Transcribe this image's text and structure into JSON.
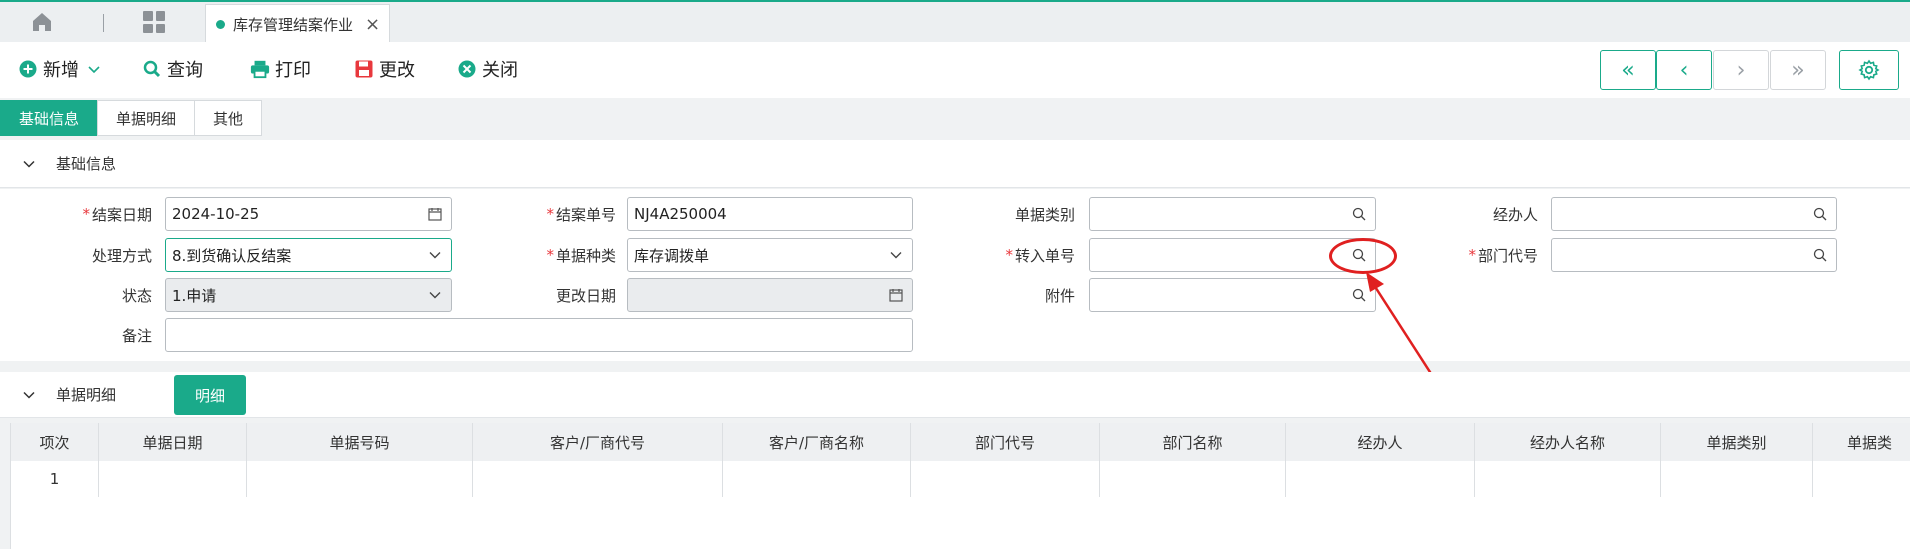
{
  "tabbar": {
    "home_icon": "home-icon",
    "apps_icon": "grid-icon",
    "active_tab": {
      "label": "库存管理结案作业",
      "close": "×"
    }
  },
  "toolbar": {
    "add_label": "新增",
    "query_label": "查询",
    "print_label": "打印",
    "edit_label": "更改",
    "close_label": "关闭",
    "nav": {
      "first": "«",
      "prev": "‹",
      "next": "›",
      "last": "»"
    }
  },
  "page_tabs": [
    "基础信息",
    "单据明细",
    "其他"
  ],
  "basic_section": {
    "title": "基础信息",
    "fields": {
      "close_date": {
        "label": "结案日期",
        "value": "2024-10-25"
      },
      "close_no": {
        "label": "结案单号",
        "value": "NJ4A250004"
      },
      "doc_category": {
        "label": "单据类别",
        "value": ""
      },
      "handler": {
        "label": "经办人",
        "value": ""
      },
      "process_method": {
        "label": "处理方式",
        "value": "8.到货确认反结案"
      },
      "doc_type": {
        "label": "单据种类",
        "value": "库存调拨单"
      },
      "transfer_no": {
        "label": "转入单号",
        "value": ""
      },
      "dept_code": {
        "label": "部门代号",
        "value": ""
      },
      "status": {
        "label": "状态",
        "value": "1.申请"
      },
      "modify_date": {
        "label": "更改日期",
        "value": ""
      },
      "attachment": {
        "label": "附件",
        "value": ""
      },
      "remark": {
        "label": "备注",
        "value": ""
      }
    }
  },
  "detail_section": {
    "title": "单据明细",
    "detail_button": "明细",
    "columns": [
      "项次",
      "单据日期",
      "单据号码",
      "客户/厂商代号",
      "客户/厂商名称",
      "部门代号",
      "部门名称",
      "经办人",
      "经办人名称",
      "单据类别",
      "单据类"
    ],
    "rows": [
      [
        "1",
        "",
        "",
        "",
        "",
        "",
        "",
        "",
        "",
        "",
        ""
      ]
    ]
  },
  "colors": {
    "accent": "#1aaa8a",
    "required": "#e8383d",
    "annotation": "#e02020"
  }
}
